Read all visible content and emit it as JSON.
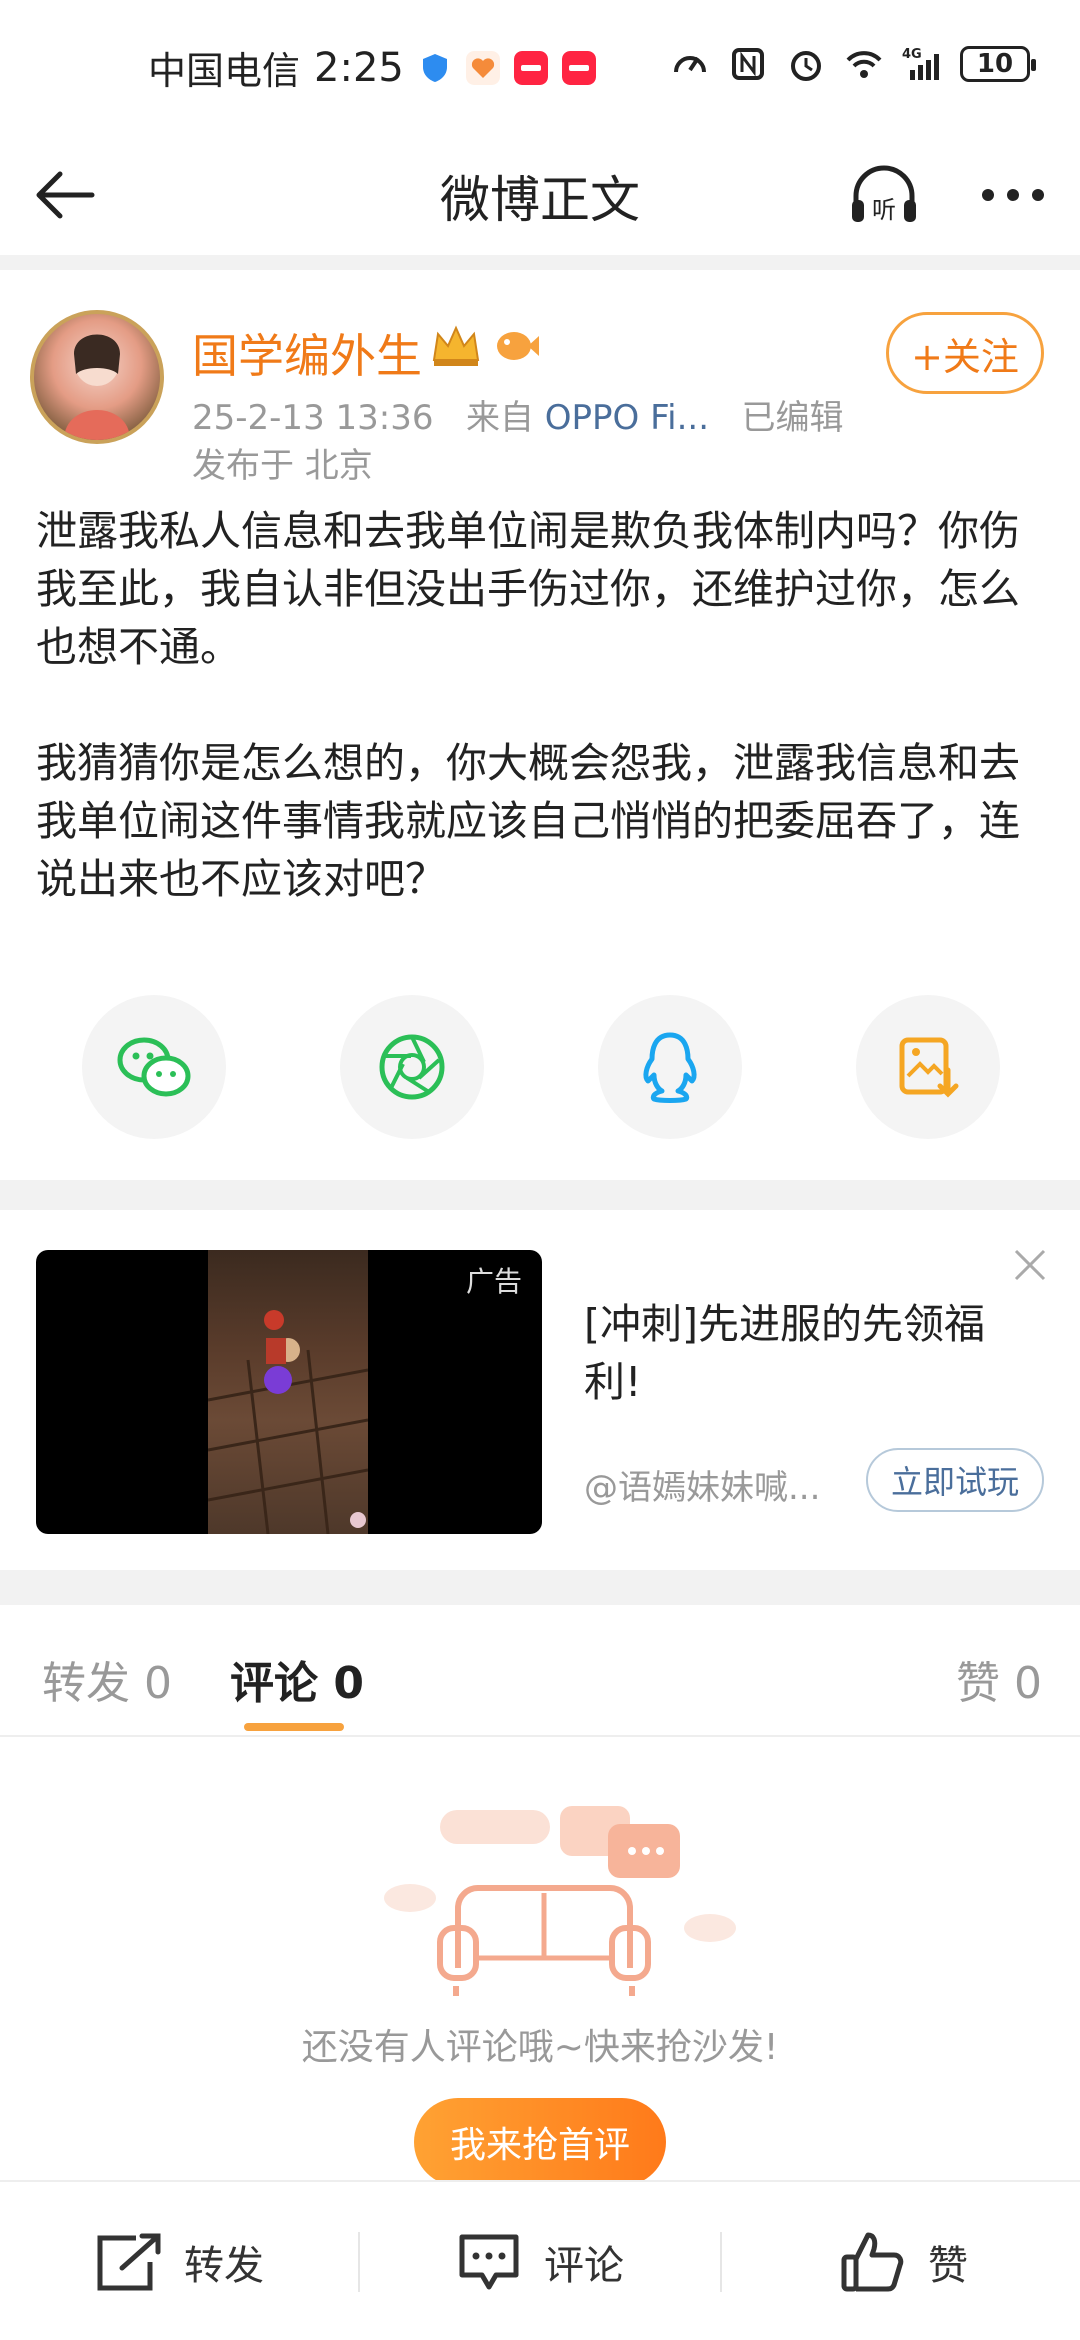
{
  "status_bar": {
    "carrier": "中国电信",
    "time": "2:25",
    "battery": "10",
    "network": "4G"
  },
  "nav": {
    "title": "微博正文"
  },
  "post": {
    "username": "国学编外生",
    "follow_label": "+关注",
    "date": "25-2-13 13:36",
    "source_prefix": "来自",
    "source": "OPPO Fi...",
    "edited": "已编辑",
    "location": "发布于 北京",
    "paragraphs": [
      "泄露我私人信息和去我单位闹是欺负我体制内吗？你伤我至此，我自认非但没出手伤过你，还维护过你，怎么也想不通。",
      "我猜猜你是怎么想的，你大概会怨我，泄露我信息和去我单位闹这件事情我就应该自己悄悄的把委屈吞了，连说出来也不应该对吧？"
    ],
    "share_icons": [
      "wechat-icon",
      "moments-icon",
      "qq-icon",
      "save-image-icon"
    ]
  },
  "ad": {
    "tag": "广告",
    "title": "[冲刺]先进服的先领福利!",
    "account": "@语嫣妹妹喊...",
    "cta": "立即试玩"
  },
  "tabs": {
    "repost": "转发 0",
    "comment": "评论 0",
    "like": "赞 0"
  },
  "empty": {
    "text": "还没有人评论哦~快来抢沙发!",
    "button": "我来抢首评"
  },
  "bottom_bar": {
    "repost": "转发",
    "comment": "评论",
    "like": "赞"
  },
  "colors": {
    "accent": "#f07a18",
    "link": "#4a6e9b",
    "wechat": "#2bbf57",
    "qq": "#1aa6f0",
    "save": "#f5a623"
  }
}
